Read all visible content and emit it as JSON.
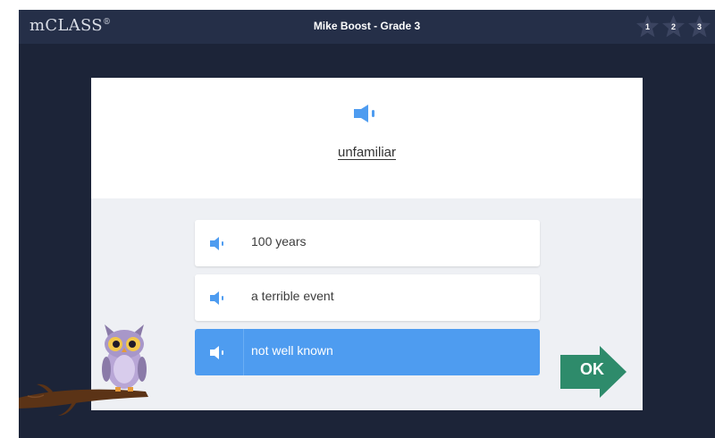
{
  "app": {
    "logo": "mCLASS",
    "logo_mark": "®",
    "title": "Mike Boost - Grade 3"
  },
  "progress": {
    "stars": [
      {
        "label": "1"
      },
      {
        "label": "2"
      },
      {
        "label": "3"
      }
    ]
  },
  "question": {
    "word": "unfamiliar",
    "speaker_icon": "speaker-icon"
  },
  "options": [
    {
      "label": "100 years",
      "selected": false
    },
    {
      "label": "a terrible event",
      "selected": false
    },
    {
      "label": "not well known",
      "selected": true
    }
  ],
  "ok_button": {
    "label": "OK",
    "color": "#2e8b6b"
  },
  "colors": {
    "background": "#1c2438",
    "header": "#252f48",
    "accent": "#4e9cf0",
    "ok": "#2e8b6b"
  }
}
